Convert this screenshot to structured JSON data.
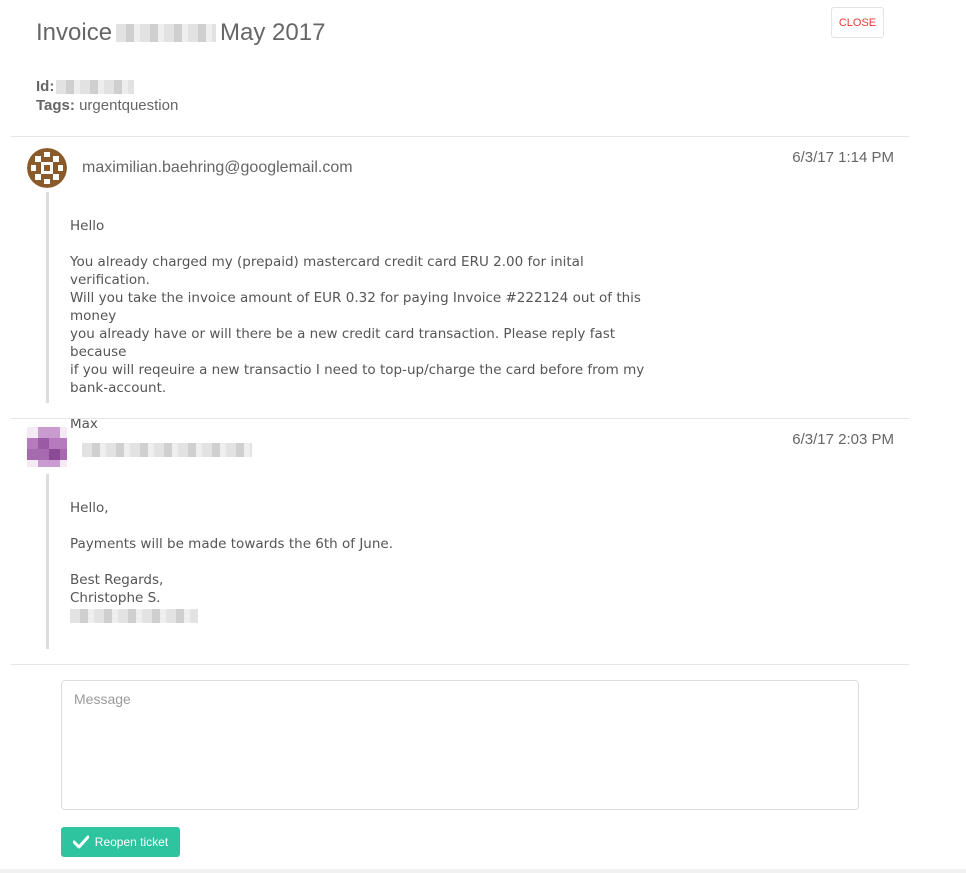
{
  "header": {
    "title_prefix": "Invoice",
    "title_suffix": "May 2017",
    "close_label": "CLOSE"
  },
  "meta": {
    "id_label": "Id:",
    "tags_label": "Tags:",
    "tags_value": "urgentquestion"
  },
  "messages": [
    {
      "sender": "maximilian.baehring@googlemail.com",
      "timestamp": "6/3/17 1:14 PM",
      "body": [
        "Hello",
        "",
        "You already charged my (prepaid) mastercard credit card ERU 2.00 for inital verification.",
        "Will you take the invoice amount of EUR 0.32 for paying Invoice #222124 out of this money",
        "you already have or will there be a new credit card transaction. Please reply fast because",
        "if you will reqeuire a new transactio I need to top-up/charge the card before from my",
        "bank-account.",
        "",
        "Max"
      ]
    },
    {
      "sender": "",
      "timestamp": "6/3/17 2:03 PM",
      "body": [
        "Hello,",
        "",
        "Payments will be made towards the 6th of June.",
        "",
        "Best Regards,",
        "Christophe S."
      ]
    }
  ],
  "composer": {
    "placeholder": "Message",
    "reopen_label": "Reopen ticket"
  },
  "colors": {
    "accent_green": "#2ec4a0",
    "close_red": "#e53935"
  }
}
